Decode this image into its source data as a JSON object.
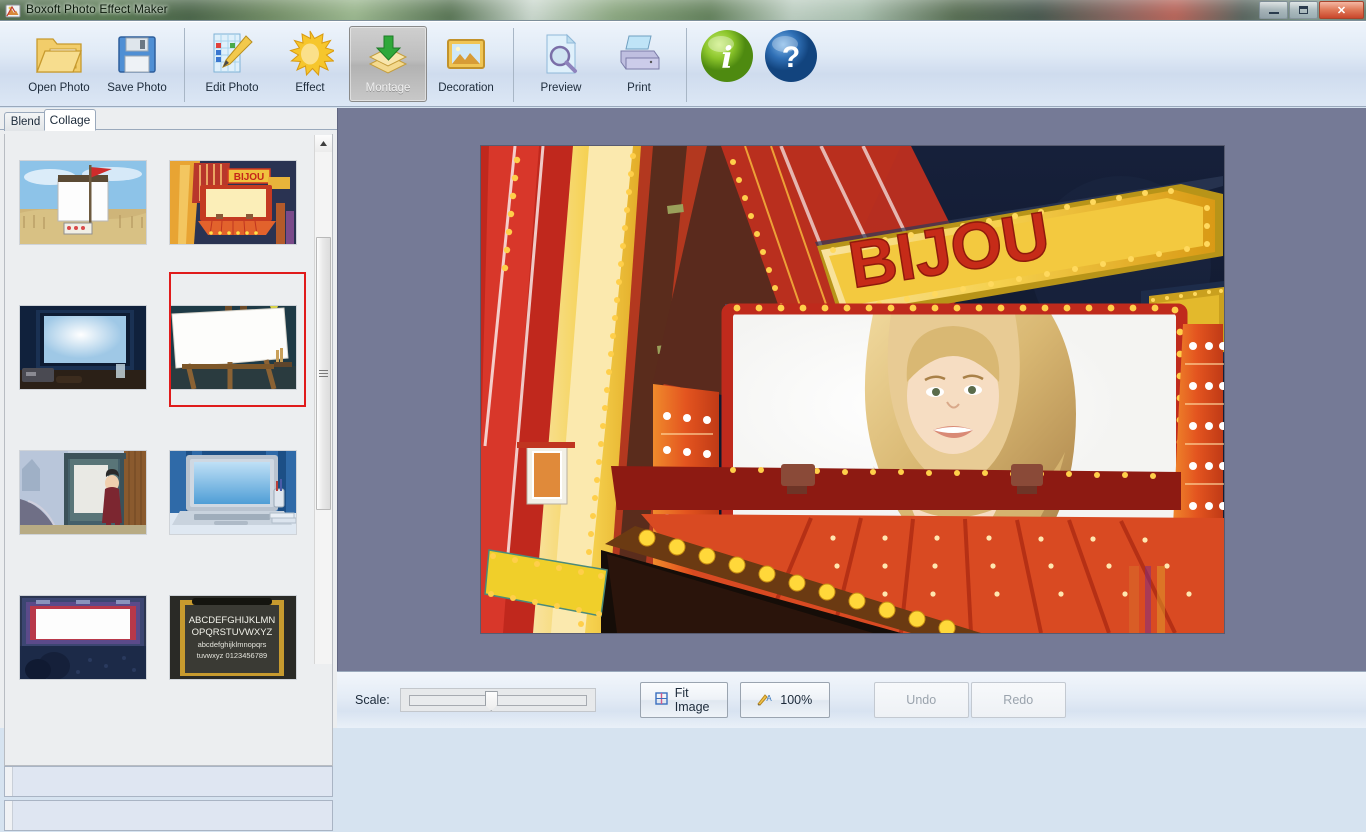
{
  "window": {
    "title": "Boxoft Photo Effect Maker",
    "app_icon": "app-icon",
    "minimize_label": "Minimize",
    "maximize_label": "Restore",
    "close_label": "Close",
    "close_glyph": "✕"
  },
  "toolbar": {
    "buttons": [
      {
        "label": "Open Photo",
        "icon": "open-folder-icon",
        "active": false
      },
      {
        "label": "Save Photo",
        "icon": "floppy-disk-icon",
        "active": false
      },
      {
        "label": "Edit Photo",
        "icon": "pencil-grid-icon",
        "active": false
      },
      {
        "label": "Effect",
        "icon": "sun-burst-icon",
        "active": false
      },
      {
        "label": "Montage",
        "icon": "layers-arrow-icon",
        "active": true
      },
      {
        "label": "Decoration",
        "icon": "picture-frame-icon",
        "active": false
      },
      {
        "label": "Preview",
        "icon": "magnifier-page-icon",
        "active": false
      },
      {
        "label": "Print",
        "icon": "printer-icon",
        "active": false
      }
    ],
    "info_button": {
      "label": "i",
      "icon": "info-icon"
    },
    "help_button": {
      "label": "?",
      "icon": "help-icon"
    }
  },
  "left_panel": {
    "tabs": [
      {
        "label": "Blend",
        "selected": false
      },
      {
        "label": "Collage",
        "selected": true
      }
    ],
    "templates": [
      {
        "name": "beach-sign-template",
        "selected": false
      },
      {
        "name": "bijou-marquee-template",
        "selected": true
      },
      {
        "name": "projector-screen-template",
        "selected": false
      },
      {
        "name": "easel-canvas-template",
        "selected": false
      },
      {
        "name": "bus-stop-billboard-template",
        "selected": false
      },
      {
        "name": "laptop-screen-template",
        "selected": false
      },
      {
        "name": "cinema-screen-template",
        "selected": false
      },
      {
        "name": "chalkboard-template",
        "selected": false
      }
    ],
    "chalkboard_text": [
      "ABCDEFGHIJKLMN",
      "OPQRSTUVWXYZ",
      "abcdefghijklmnopqrs",
      "tuvwxyz  0123456789"
    ],
    "scrollbar": {
      "up_arrow": "▲",
      "grip": "scroll-grip"
    }
  },
  "canvas": {
    "background_color": "#757a96",
    "preview": {
      "name": "bijou-marquee-preview",
      "sign_text": "BIJOU",
      "subject": "portrait-photo-of-woman"
    }
  },
  "bottom_bar": {
    "scale_label": "Scale:",
    "scale_value": 50,
    "fit_image_label": "Fit Image",
    "fit_image_icon": "fit-image-icon",
    "zoom_100_label": "100%",
    "zoom_100_icon": "actual-size-icon",
    "undo_label": "Undo",
    "redo_label": "Redo",
    "undo_enabled": false,
    "redo_enabled": false
  },
  "colors": {
    "canvas_bg": "#757a96",
    "toolbar_top": "#eef4fb",
    "selection_red": "#e01b1b",
    "panel_bg": "#eceef0"
  }
}
